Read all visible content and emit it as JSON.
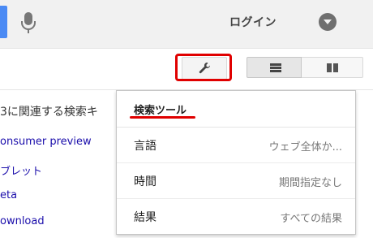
{
  "header": {
    "login_label": "ログイン"
  },
  "icons": {
    "mic": "microphone-icon",
    "account": "chevron-down-icon",
    "tools": "wrench-icon",
    "list": "list-view-icon",
    "grid": "grid-view-icon"
  },
  "results": {
    "related_text": "3に関連する検索キ",
    "links": [
      "onsumer preview",
      "ブレット",
      "eta",
      "ownload"
    ]
  },
  "search_tools": {
    "title": "検索ツール",
    "rows": [
      {
        "label": "言語",
        "value": "ウェブ全体か..."
      },
      {
        "label": "時間",
        "value": "期間指定なし"
      },
      {
        "label": "結果",
        "value": "すべての結果"
      }
    ]
  },
  "colors": {
    "highlight": "#e00000",
    "link": "#1a0dab",
    "search_accent": "#4a8af4"
  }
}
